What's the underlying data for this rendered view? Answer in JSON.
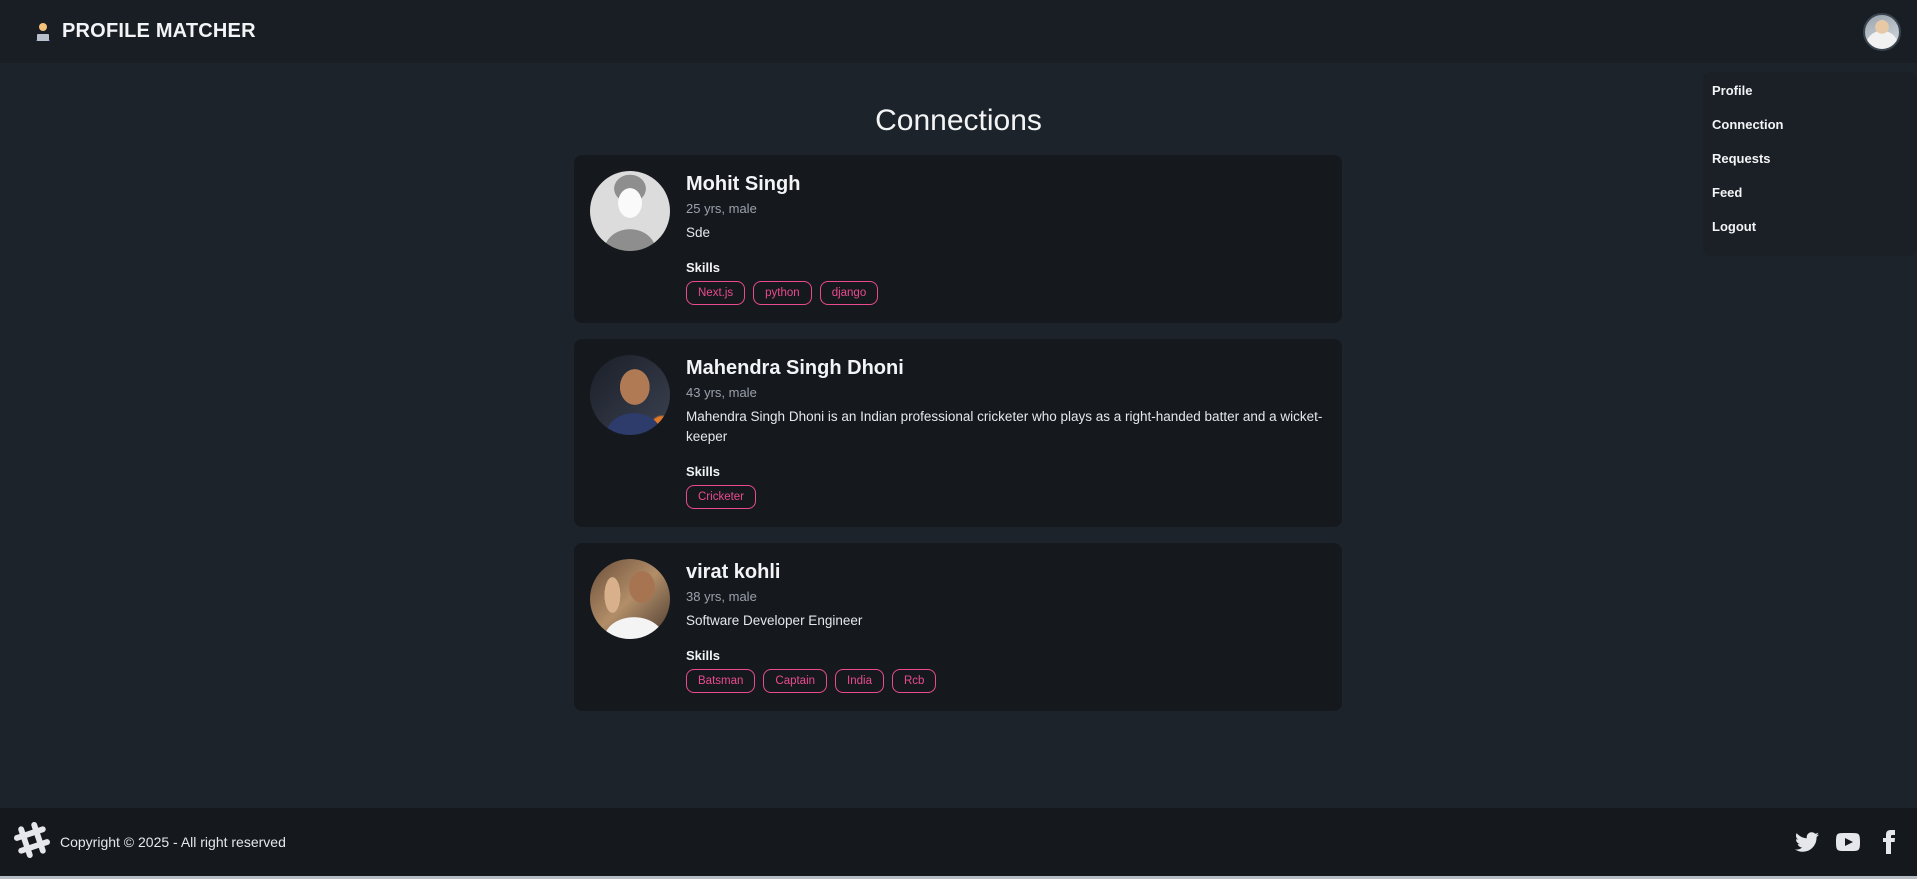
{
  "navbar": {
    "brand_emoji": "🧑‍💻",
    "brand_title": "PROFILE MATCHER",
    "avatar_icon": "user-avatar"
  },
  "menu": {
    "items": [
      "Profile",
      "Connection",
      "Requests",
      "Feed",
      "Logout"
    ]
  },
  "page": {
    "title": "Connections"
  },
  "connections": [
    {
      "name": "Mohit Singh",
      "meta": "25 yrs, male",
      "about": "Sde",
      "skills_label": "Skills",
      "skills": [
        "Next.js",
        "python",
        "django"
      ]
    },
    {
      "name": "Mahendra Singh Dhoni",
      "meta": "43 yrs, male",
      "about": "Mahendra Singh Dhoni is an Indian professional cricketer who plays as a right-handed batter and a wicket-keeper",
      "skills_label": "Skills",
      "skills": [
        "Cricketer"
      ]
    },
    {
      "name": "virat kohli",
      "meta": "38 yrs, male",
      "about": "Software Developer Engineer",
      "skills_label": "Skills",
      "skills": [
        "Batsman",
        "Captain",
        "India",
        "Rcb"
      ]
    }
  ],
  "footer": {
    "copyright": "Copyright © 2025 - All right reserved",
    "icons": [
      "hashtag-icon",
      "twitter-icon",
      "youtube-icon",
      "facebook-icon"
    ]
  },
  "colors": {
    "background": "#1d232a",
    "navbar": "#191e24",
    "card": "#15191e",
    "skill_accent": "#e94b8e"
  }
}
